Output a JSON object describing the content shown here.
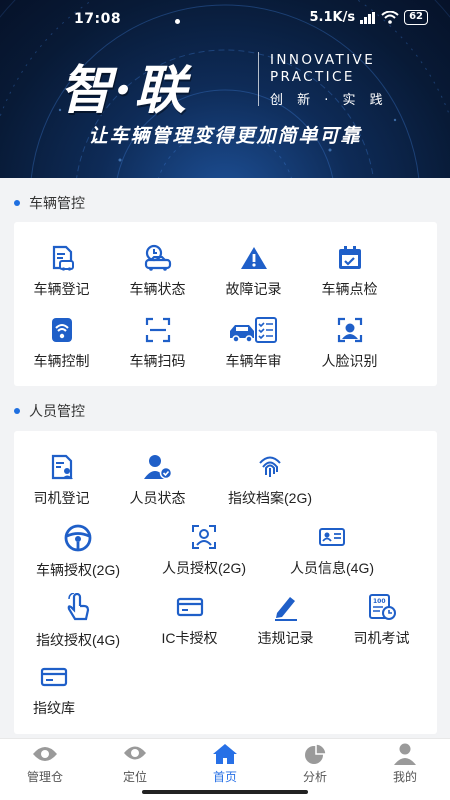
{
  "status_bar": {
    "time": "17:08",
    "net_speed": "5.1K/s",
    "battery": "62"
  },
  "banner": {
    "logo_cn": "智·联",
    "logo_en_line1": "INNOVATIVE",
    "logo_en_line2": "PRACTICE",
    "logo_cn_sub": "创 新 · 实 践",
    "slogan": "让车辆管理变得更加简单可靠"
  },
  "sections": [
    {
      "title": "车辆管控",
      "items": [
        {
          "label": "车辆登记",
          "icon": "vehicle-register-icon"
        },
        {
          "label": "车辆状态",
          "icon": "vehicle-status-icon"
        },
        {
          "label": "故障记录",
          "icon": "warning-icon"
        },
        {
          "label": "车辆点检",
          "icon": "inspection-icon"
        },
        {
          "label": "车辆控制",
          "icon": "vehicle-control-icon"
        },
        {
          "label": "车辆扫码",
          "icon": "scan-icon"
        },
        {
          "label": "车辆年审",
          "icon": "annual-review-icon"
        },
        {
          "label": "人脸识别",
          "icon": "face-recognition-icon"
        }
      ]
    },
    {
      "title": "人员管控",
      "items": [
        {
          "label": "司机登记",
          "icon": "driver-register-icon"
        },
        {
          "label": "人员状态",
          "icon": "person-status-icon"
        },
        {
          "label": "指纹档案(2G)",
          "icon": "fingerprint-icon"
        },
        {
          "label": "车辆授权(2G)",
          "icon": "steering-wheel-icon"
        },
        {
          "label": "人员授权(2G)",
          "icon": "person-auth-icon"
        },
        {
          "label": "人员信息(4G)",
          "icon": "id-card-icon"
        },
        {
          "label": "指纹授权(4G)",
          "icon": "touch-icon"
        },
        {
          "label": "IC卡授权",
          "icon": "ic-card-icon"
        },
        {
          "label": "违规记录",
          "icon": "violation-icon"
        },
        {
          "label": "司机考试",
          "icon": "exam-icon"
        },
        {
          "label": "指纹库",
          "icon": "fingerprint-library-icon"
        }
      ]
    }
  ],
  "bottom_nav": [
    {
      "label": "管理仓",
      "icon": "eye-icon",
      "active": false
    },
    {
      "label": "定位",
      "icon": "location-icon",
      "active": false
    },
    {
      "label": "首页",
      "icon": "home-icon",
      "active": true
    },
    {
      "label": "分析",
      "icon": "pie-chart-icon",
      "active": false
    },
    {
      "label": "我的",
      "icon": "user-icon",
      "active": false
    }
  ],
  "colors": {
    "accent": "#2770e6",
    "banner_dark": "#081a36",
    "icon_blue": "#1f5fc8"
  }
}
